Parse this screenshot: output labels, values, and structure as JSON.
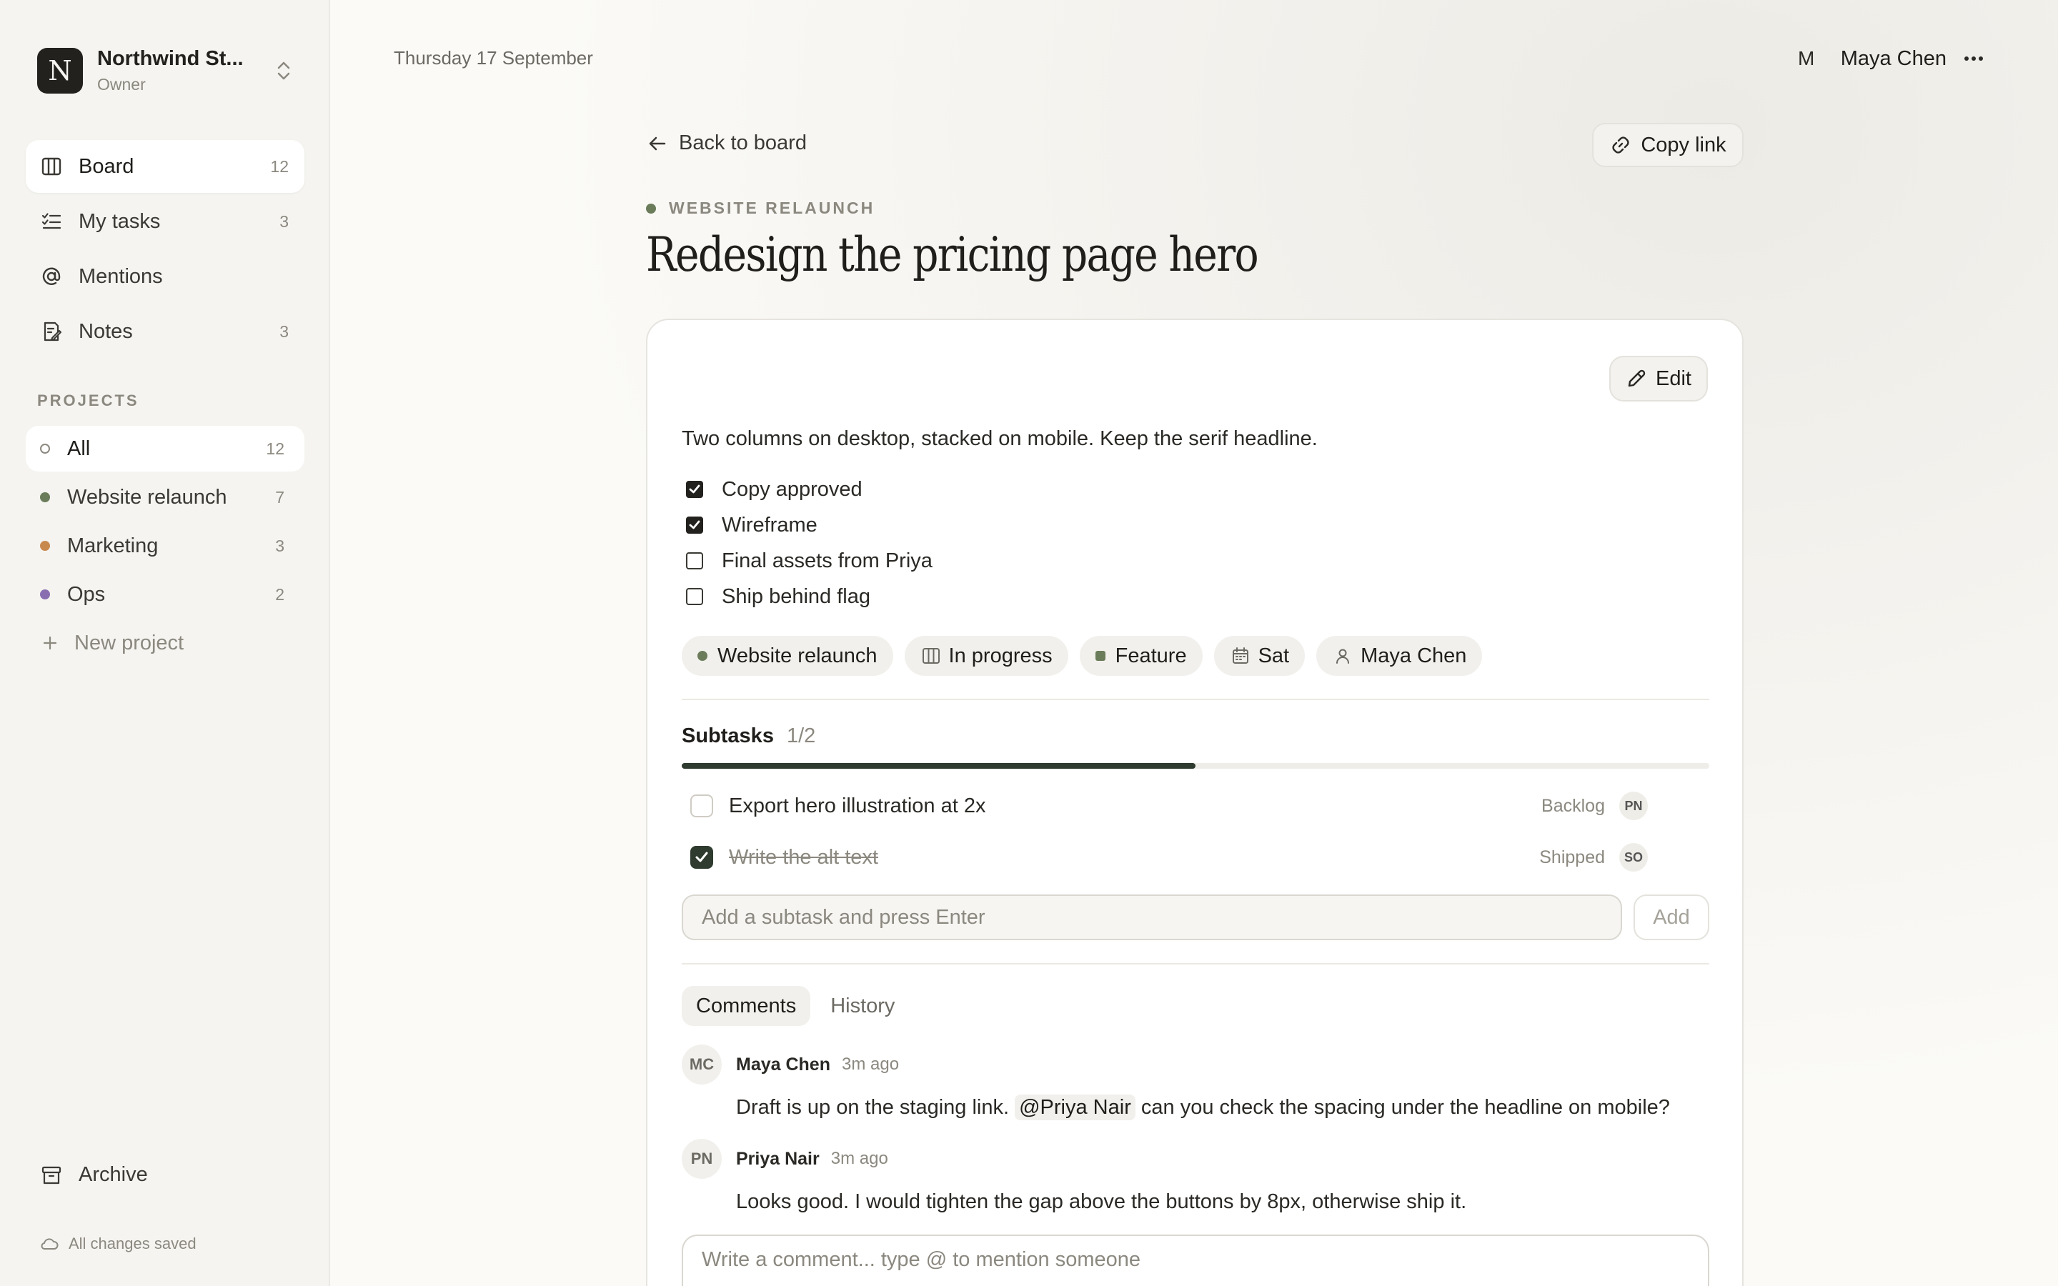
{
  "workspace": {
    "logo_letter": "N",
    "name": "Northwind St...",
    "role": "Owner"
  },
  "nav": {
    "items": [
      {
        "label": "Board",
        "count": "12",
        "icon": "board-icon",
        "active": true
      },
      {
        "label": "My tasks",
        "count": "3",
        "icon": "list-check-icon"
      },
      {
        "label": "Mentions",
        "count": "",
        "icon": "at-icon"
      },
      {
        "label": "Notes",
        "count": "3",
        "icon": "note-icon"
      }
    ]
  },
  "projects": {
    "heading": "PROJECTS",
    "items": [
      {
        "label": "All",
        "count": "12",
        "color": "#8b887f",
        "active": true
      },
      {
        "label": "Website relaunch",
        "count": "7",
        "color": "#6a7c5a"
      },
      {
        "label": "Marketing",
        "count": "3",
        "color": "#c8894f"
      },
      {
        "label": "Ops",
        "count": "2",
        "color": "#8a6fb0"
      }
    ],
    "new_label": "New project"
  },
  "footer": {
    "archive_label": "Archive",
    "saved_label": "All changes saved"
  },
  "header": {
    "date": "Thursday 17 September",
    "user_initial": "M",
    "user_name": "Maya Chen"
  },
  "task": {
    "back_label": "Back to board",
    "copy_link_label": "Copy link",
    "project_tag": "WEBSITE RELAUNCH",
    "title": "Redesign the pricing page hero",
    "edit_label": "Edit",
    "description": "Two columns on desktop, stacked on mobile. Keep the serif headline.",
    "checklist": [
      {
        "label": "Copy approved",
        "checked": true
      },
      {
        "label": "Wireframe",
        "checked": true
      },
      {
        "label": "Final assets from Priya",
        "checked": false
      },
      {
        "label": "Ship behind flag",
        "checked": false
      }
    ],
    "chips": {
      "project": "Website relaunch",
      "status": "In progress",
      "type": "Feature",
      "due": "Sat",
      "assignee": "Maya Chen"
    },
    "colors": {
      "project_dot": "#6a7c5a",
      "feature_square": "#6a7c5a",
      "progress": "#2e3b2e"
    }
  },
  "subtasks": {
    "heading": "Subtasks",
    "progress_text": "1/2",
    "progress_fraction": 0.5,
    "items": [
      {
        "title": "Export hero illustration at 2x",
        "status": "Backlog",
        "assignee": "PN",
        "done": false
      },
      {
        "title": "Write the alt text",
        "status": "Shipped",
        "assignee": "SO",
        "done": true
      }
    ],
    "input_placeholder": "Add a subtask and press Enter",
    "add_label": "Add"
  },
  "activity": {
    "tabs": [
      "Comments",
      "History"
    ],
    "comments": [
      {
        "initials": "MC",
        "author": "Maya Chen",
        "time": "3m ago",
        "text_before": "Draft is up on the staging link. ",
        "mention": "@Priya Nair",
        "text_after": " can you check the spacing under the headline on mobile?"
      },
      {
        "initials": "PN",
        "author": "Priya Nair",
        "time": "3m ago",
        "text_before": "Looks good. I would tighten the gap above the buttons by 8px, otherwise ship it.",
        "mention": "",
        "text_after": ""
      }
    ],
    "input_placeholder": "Write a comment... type @ to mention someone"
  }
}
